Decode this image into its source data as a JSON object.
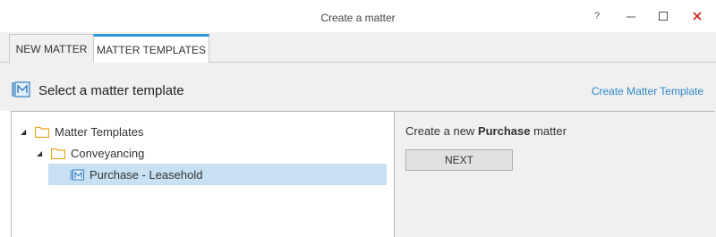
{
  "window": {
    "title": "Create a matter",
    "help_label": "?"
  },
  "tabs": [
    {
      "label": "NEW MATTER",
      "active": false
    },
    {
      "label": "MATTER TEMPLATES",
      "active": true
    }
  ],
  "header": {
    "title": "Select a matter template",
    "link_label": "Create Matter Template"
  },
  "tree": {
    "items": [
      {
        "label": "Matter Templates",
        "icon": "folder-icon",
        "expanded": true
      },
      {
        "label": "Conveyancing",
        "icon": "folder-icon",
        "expanded": true
      },
      {
        "label": "Purchase - Leasehold",
        "icon": "matter-template-icon",
        "selected": true
      }
    ]
  },
  "right_pane": {
    "prefix": "Create a new ",
    "matter_type": "Purchase",
    "suffix": " matter",
    "next_label": "NEXT"
  },
  "colors": {
    "accent": "#2c98d8",
    "link": "#2f88c8",
    "selection": "#c7e0f4",
    "folder": "#e8a317",
    "close": "#c02020"
  }
}
